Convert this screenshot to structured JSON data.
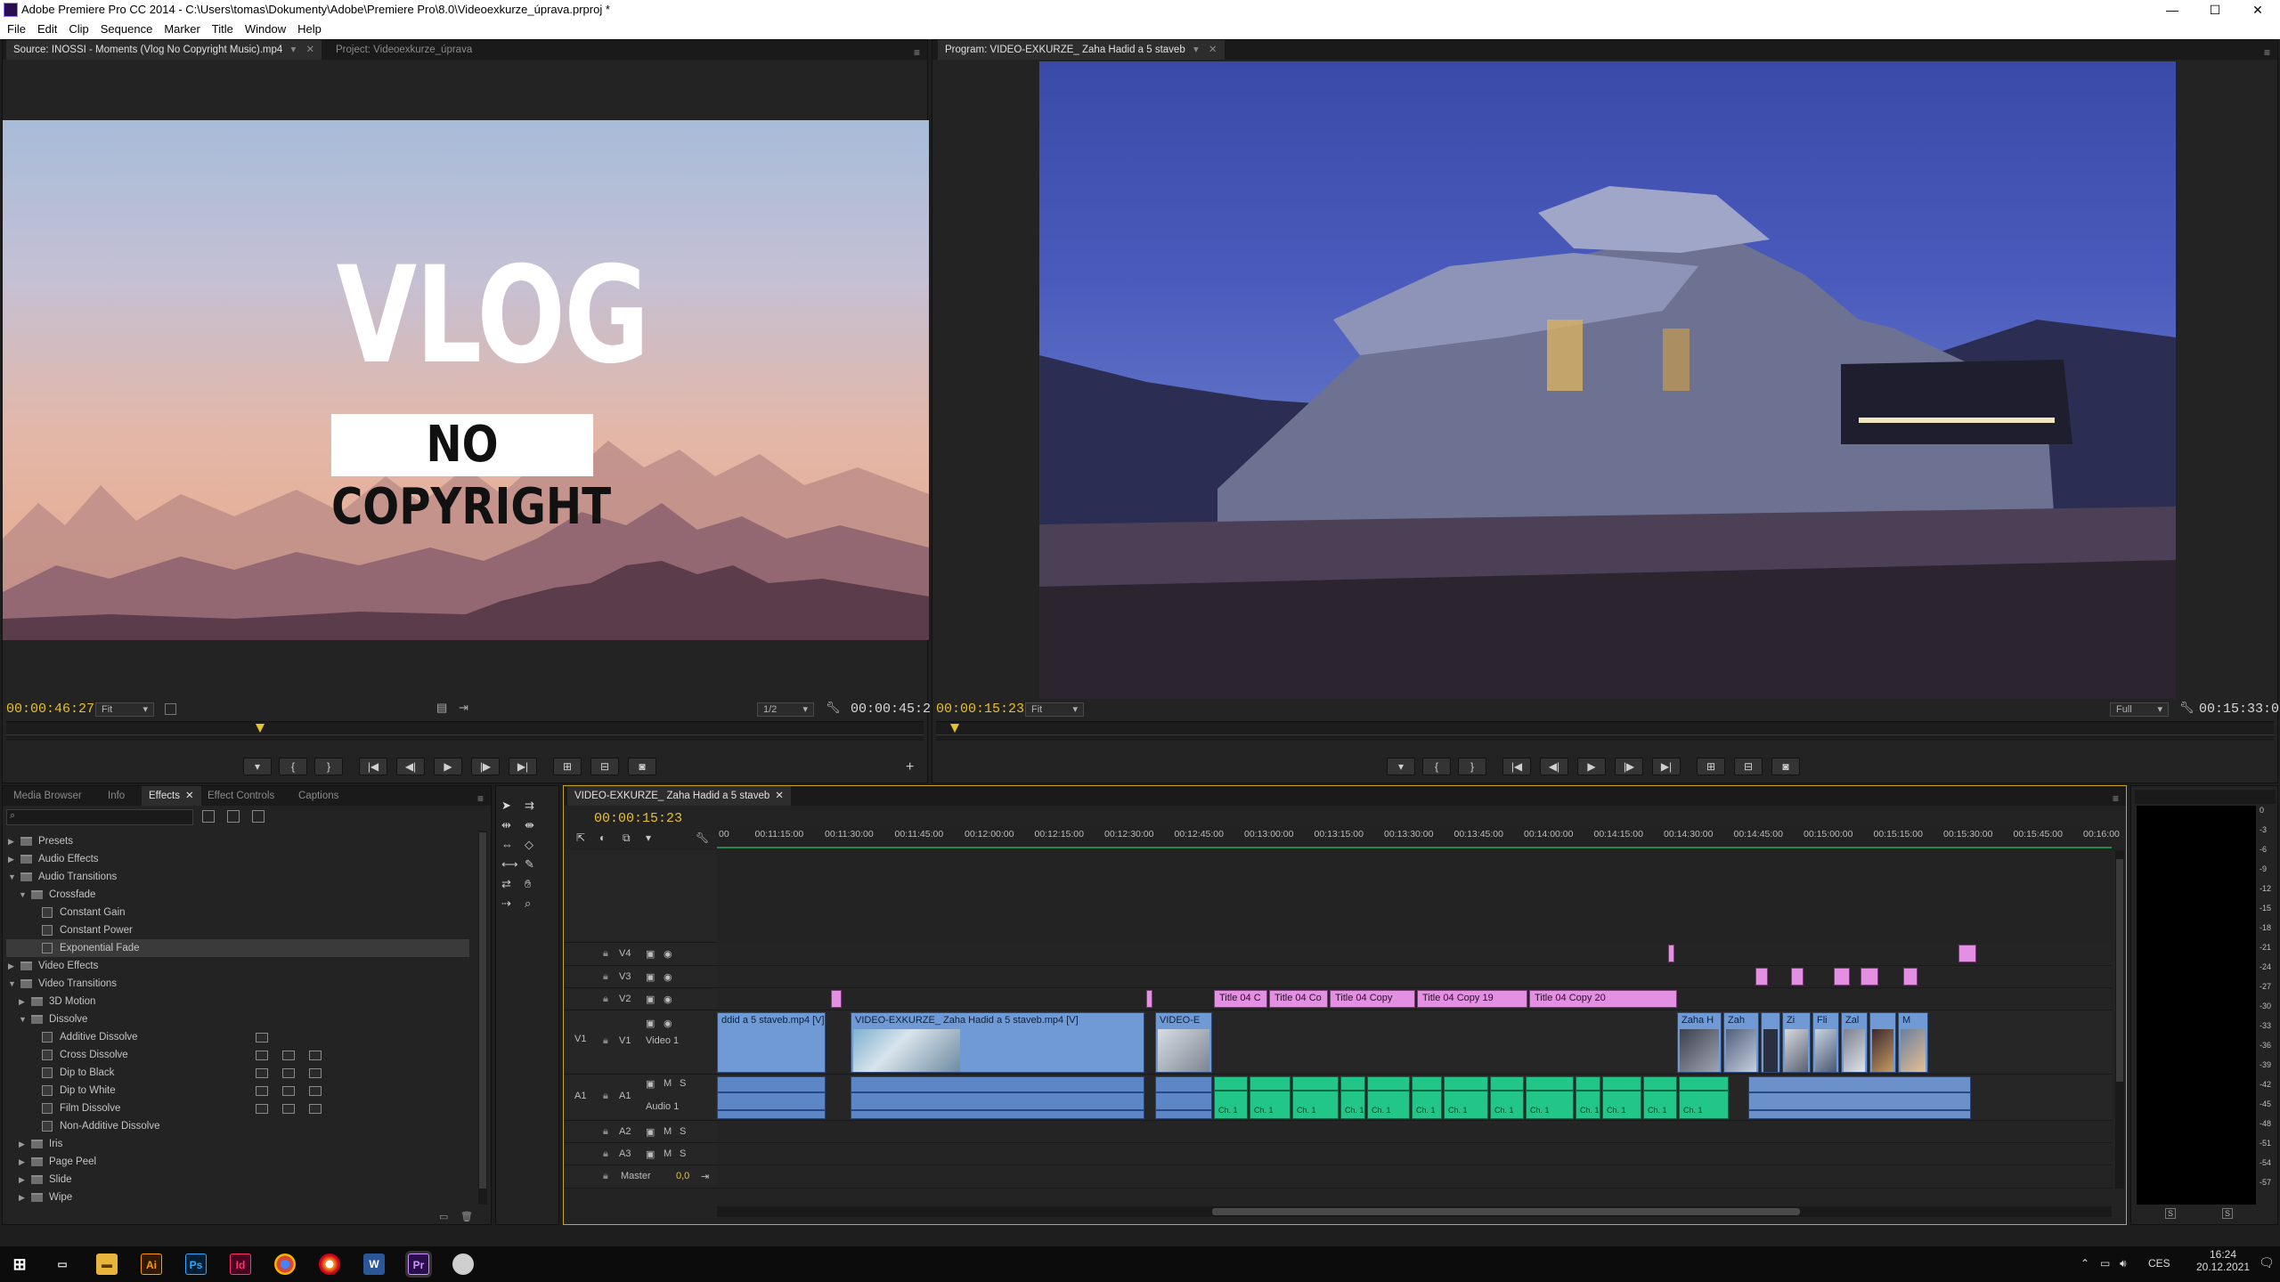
{
  "window": {
    "title": "Adobe Premiere Pro CC 2014 - C:\\Users\\tomas\\Dokumenty\\Adobe\\Premiere Pro\\8.0\\Videoexkurze_úprava.prproj *",
    "minimize": "—",
    "maximize": "☐",
    "close": "✕"
  },
  "menu": [
    "File",
    "Edit",
    "Clip",
    "Sequence",
    "Marker",
    "Title",
    "Window",
    "Help"
  ],
  "source_monitor": {
    "tab_source": "Source: INOSSI - Moments (Vlog No Copyright Music).mp4",
    "tab_project": "Project: Videoexkurze_úprava",
    "overlay_title": "VLOG",
    "overlay_subtitle": "NO COPYRIGHT",
    "timecode_in": "00:00:46:27",
    "fit": "Fit",
    "resolution": "1/2",
    "timecode_dur": "00:00:45:23"
  },
  "program_monitor": {
    "tab": "Program: VIDEO-EXKURZE_ Zaha Hadid a 5 staveb",
    "timecode_in": "00:00:15:23",
    "fit": "Fit",
    "resolution": "Full",
    "timecode_dur": "00:15:33:06"
  },
  "effects_panel": {
    "tabs": [
      "Media Browser",
      "Info",
      "Effects",
      "Effect Controls",
      "Captions"
    ],
    "active_tab": "Effects",
    "search_placeholder": "",
    "tree": [
      {
        "label": "Presets",
        "level": 0,
        "type": "folder",
        "expanded": false
      },
      {
        "label": "Audio Effects",
        "level": 0,
        "type": "folder",
        "expanded": false
      },
      {
        "label": "Audio Transitions",
        "level": 0,
        "type": "folder",
        "expanded": true
      },
      {
        "label": "Crossfade",
        "level": 1,
        "type": "folder",
        "expanded": true
      },
      {
        "label": "Constant Gain",
        "level": 2,
        "type": "fx"
      },
      {
        "label": "Constant Power",
        "level": 2,
        "type": "fx"
      },
      {
        "label": "Exponential Fade",
        "level": 2,
        "type": "fx",
        "selected": true
      },
      {
        "label": "Video Effects",
        "level": 0,
        "type": "folder",
        "expanded": false
      },
      {
        "label": "Video Transitions",
        "level": 0,
        "type": "folder",
        "expanded": true
      },
      {
        "label": "3D Motion",
        "level": 1,
        "type": "folder",
        "expanded": false
      },
      {
        "label": "Dissolve",
        "level": 1,
        "type": "folder",
        "expanded": true
      },
      {
        "label": "Additive Dissolve",
        "level": 2,
        "type": "fx",
        "badges": 1
      },
      {
        "label": "Cross Dissolve",
        "level": 2,
        "type": "fx",
        "badges": 3
      },
      {
        "label": "Dip to Black",
        "level": 2,
        "type": "fx",
        "badges": 3
      },
      {
        "label": "Dip to White",
        "level": 2,
        "type": "fx",
        "badges": 3
      },
      {
        "label": "Film Dissolve",
        "level": 2,
        "type": "fx",
        "badges": 3
      },
      {
        "label": "Non-Additive Dissolve",
        "level": 2,
        "type": "fx",
        "badges": 0
      },
      {
        "label": "Iris",
        "level": 1,
        "type": "folder",
        "expanded": false
      },
      {
        "label": "Page Peel",
        "level": 1,
        "type": "folder",
        "expanded": false
      },
      {
        "label": "Slide",
        "level": 1,
        "type": "folder",
        "expanded": false
      },
      {
        "label": "Wipe",
        "level": 1,
        "type": "folder",
        "expanded": false
      }
    ]
  },
  "timeline": {
    "tab": "VIDEO-EXKURZE_ Zaha Hadid a 5 staveb",
    "timecode": "00:00:15:23",
    "ruler": [
      "00",
      "00:11:15:00",
      "00:11:30:00",
      "00:11:45:00",
      "00:12:00:00",
      "00:12:15:00",
      "00:12:30:00",
      "00:12:45:00",
      "00:13:00:00",
      "00:13:15:00",
      "00:13:30:00",
      "00:13:45:00",
      "00:14:00:00",
      "00:14:15:00",
      "00:14:30:00",
      "00:14:45:00",
      "00:15:00:00",
      "00:15:15:00",
      "00:15:30:00",
      "00:15:45:00",
      "00:16:00"
    ],
    "tracks": {
      "v4": "V4",
      "v3": "V3",
      "v2": "V2",
      "v1": "V1",
      "v1_name": "Video 1",
      "a1": "A1",
      "a1_name": "Audio 1",
      "a2": "A2",
      "a3": "A3",
      "master": "Master",
      "master_value": "0,0",
      "m": "M",
      "s": "S"
    },
    "video_clips": [
      "ddid a 5 staveb.mp4 [V]",
      "VIDEO-EXKURZE_ Zaha Hadid a 5 staveb.mp4 [V]",
      "VIDEO-E",
      "Zaha H",
      "Zah",
      "Zi",
      "Fli",
      "Zal",
      "M"
    ],
    "titles_v2": [
      "Title 04 C",
      "Title 04 Co",
      "Title 04 Copy",
      "Title 04 Copy 19",
      "Title 04 Copy 20"
    ],
    "audio_labels": [
      "Ch. 1"
    ]
  },
  "meter": {
    "scale": [
      "0",
      "-3",
      "-6",
      "-9",
      "-12",
      "-15",
      "-18",
      "-21",
      "-24",
      "-27",
      "-30",
      "-33",
      "-36",
      "-39",
      "-42",
      "-45",
      "-48",
      "-51",
      "-54",
      "-57"
    ],
    "s1": "S",
    "s2": "S"
  },
  "taskbar": {
    "apps": [
      "File Explorer",
      "Ai",
      "Ps",
      "Id",
      "Chrome",
      "Opera",
      "W",
      "Pr",
      "App"
    ],
    "lang": "CES",
    "time": "16:24",
    "date": "20.12.2021"
  }
}
